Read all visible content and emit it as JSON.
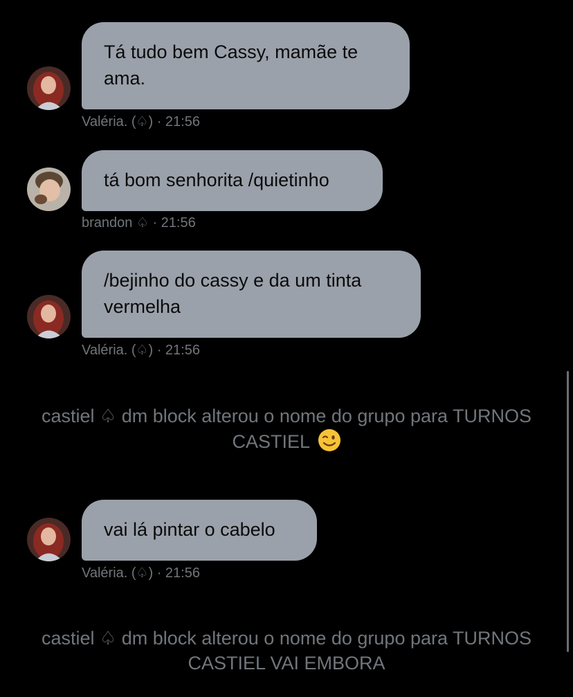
{
  "messages": [
    {
      "sender": "Valéria. (♤)",
      "time": "· 21:56",
      "text": "Tá tudo bem Cassy, mamãe te ama.",
      "avatar": "valeria-avatar"
    },
    {
      "sender": "brandon ♤",
      "time": "· 21:56",
      "text": "tá bom senhorita /quietinho",
      "avatar": "brandon-avatar"
    },
    {
      "sender": "Valéria. (♤)",
      "time": "· 21:56",
      "text": "/bejinho do cassy e da um tinta vermelha",
      "avatar": "valeria-avatar"
    },
    {
      "sender": "Valéria. (♤)",
      "time": "· 21:56",
      "text": "vai lá pintar o cabelo",
      "avatar": "valeria-avatar"
    }
  ],
  "system_events": [
    {
      "text": "castiel ♤ dm block alterou o nome do grupo para TURNOS CASTIEL",
      "emoji": "winking-face-emoji"
    },
    {
      "text": "castiel ♤ dm block alterou o nome do grupo para TURNOS CASTIEL VAI EMBORA"
    }
  ],
  "colors": {
    "background": "#000000",
    "bubble": "#9ba1aa",
    "bubble_text": "#0b0b0c",
    "meta_text": "#71767b"
  }
}
